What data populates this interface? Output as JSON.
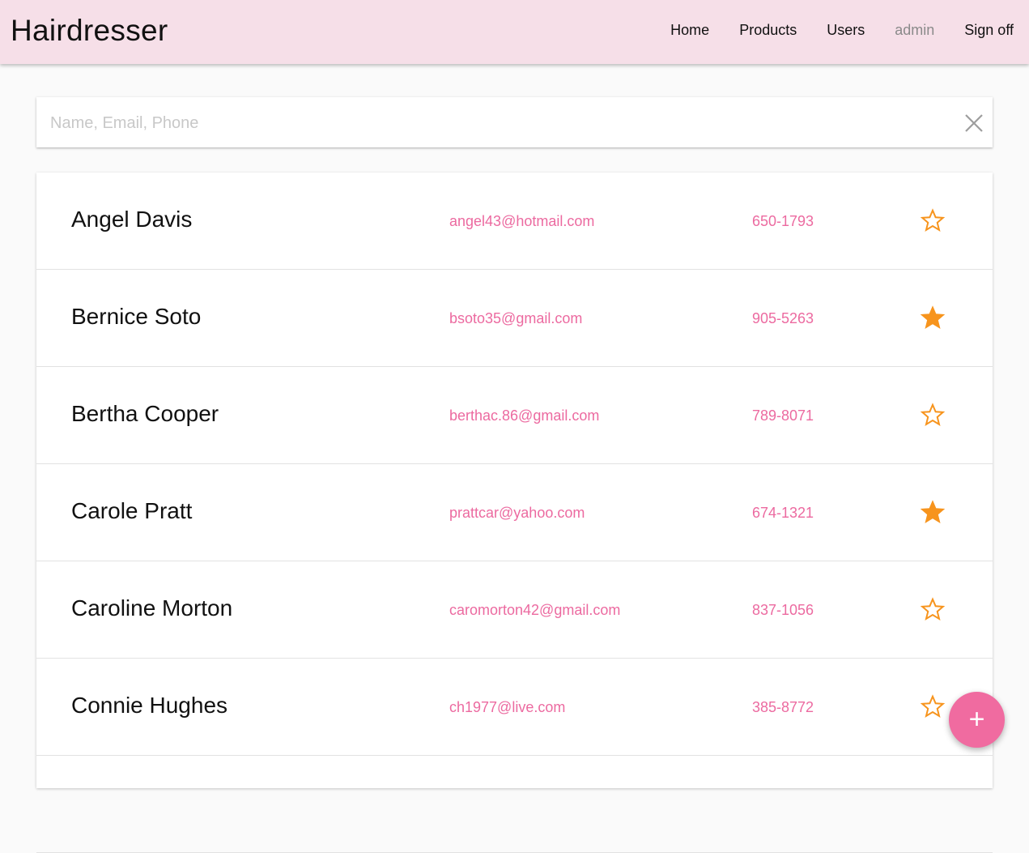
{
  "app": {
    "title": "Hairdresser",
    "accent": "#ec6aa0",
    "header_bg": "#f6dfe8",
    "star_color": "#f7941d"
  },
  "nav": [
    {
      "label": "Home",
      "muted": false
    },
    {
      "label": "Products",
      "muted": false
    },
    {
      "label": "Users",
      "muted": false
    },
    {
      "label": "admin",
      "muted": true
    },
    {
      "label": "Sign off",
      "muted": false
    }
  ],
  "search": {
    "placeholder": "Name, Email, Phone",
    "value": "",
    "clear_icon": "close-icon"
  },
  "users": [
    {
      "name": "Angel Davis",
      "email": "angel43@hotmail.com",
      "phone": "650-1793",
      "favorite": false
    },
    {
      "name": "Bernice Soto",
      "email": "bsoto35@gmail.com",
      "phone": "905-5263",
      "favorite": true
    },
    {
      "name": "Bertha Cooper",
      "email": "berthac.86@gmail.com",
      "phone": "789-8071",
      "favorite": false
    },
    {
      "name": "Carole Pratt",
      "email": "prattcar@yahoo.com",
      "phone": "674-1321",
      "favorite": true
    },
    {
      "name": "Caroline Morton",
      "email": "caromorton42@gmail.com",
      "phone": "837-1056",
      "favorite": false
    },
    {
      "name": "Connie Hughes",
      "email": "ch1977@live.com",
      "phone": "385-8772",
      "favorite": false
    }
  ],
  "fab": {
    "label": "+",
    "icon": "plus-icon"
  }
}
